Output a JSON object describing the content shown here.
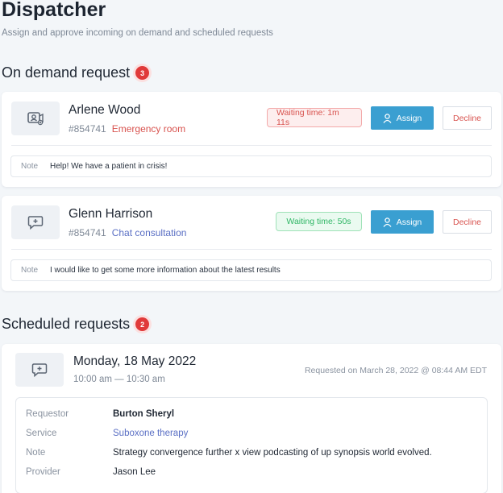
{
  "header": {
    "title": "Dispatcher",
    "subtitle": "Assign and approve incoming on demand and scheduled requests"
  },
  "on_demand": {
    "label": "On demand request",
    "count": "3",
    "requests": [
      {
        "name": "Arlene Wood",
        "id": "#854741",
        "service": "Emergency room",
        "waiting": "Waiting time: 1m 11s",
        "assign_label": "Assign",
        "decline_label": "Decline",
        "note_label": "Note",
        "note": "Help! We have a patient in crisis!"
      },
      {
        "name": "Glenn Harrison",
        "id": "#854741",
        "service": "Chat consultation",
        "waiting": "Waiting time: 50s",
        "assign_label": "Assign",
        "decline_label": "Decline",
        "note_label": "Note",
        "note": "I would like to get some more information about the latest results"
      }
    ]
  },
  "scheduled": {
    "label": "Scheduled requests",
    "count": "2",
    "request": {
      "date": "Monday, 18 May 2022",
      "time": "10:00 am — 10:30 am",
      "requested_on": "Requested on March 28, 2022 @ 08:44 AM EDT",
      "details": [
        {
          "label": "Requestor",
          "value": "Burton Sheryl"
        },
        {
          "label": "Service",
          "value": "Suboxone therapy"
        },
        {
          "label": "Note",
          "value": "Strategy convergence further x view podcasting of up synopsis world evolved."
        },
        {
          "label": "Provider",
          "value": "Jason Lee"
        }
      ]
    }
  },
  "colors": {
    "accent": "#3a9fd1",
    "danger": "#d8534f",
    "success": "#2fb665",
    "link": "#5a6fc4"
  },
  "icons": {
    "video_request": "video-call-icon",
    "chat_request": "chat-bubble-icon",
    "assign": "user-icon"
  }
}
